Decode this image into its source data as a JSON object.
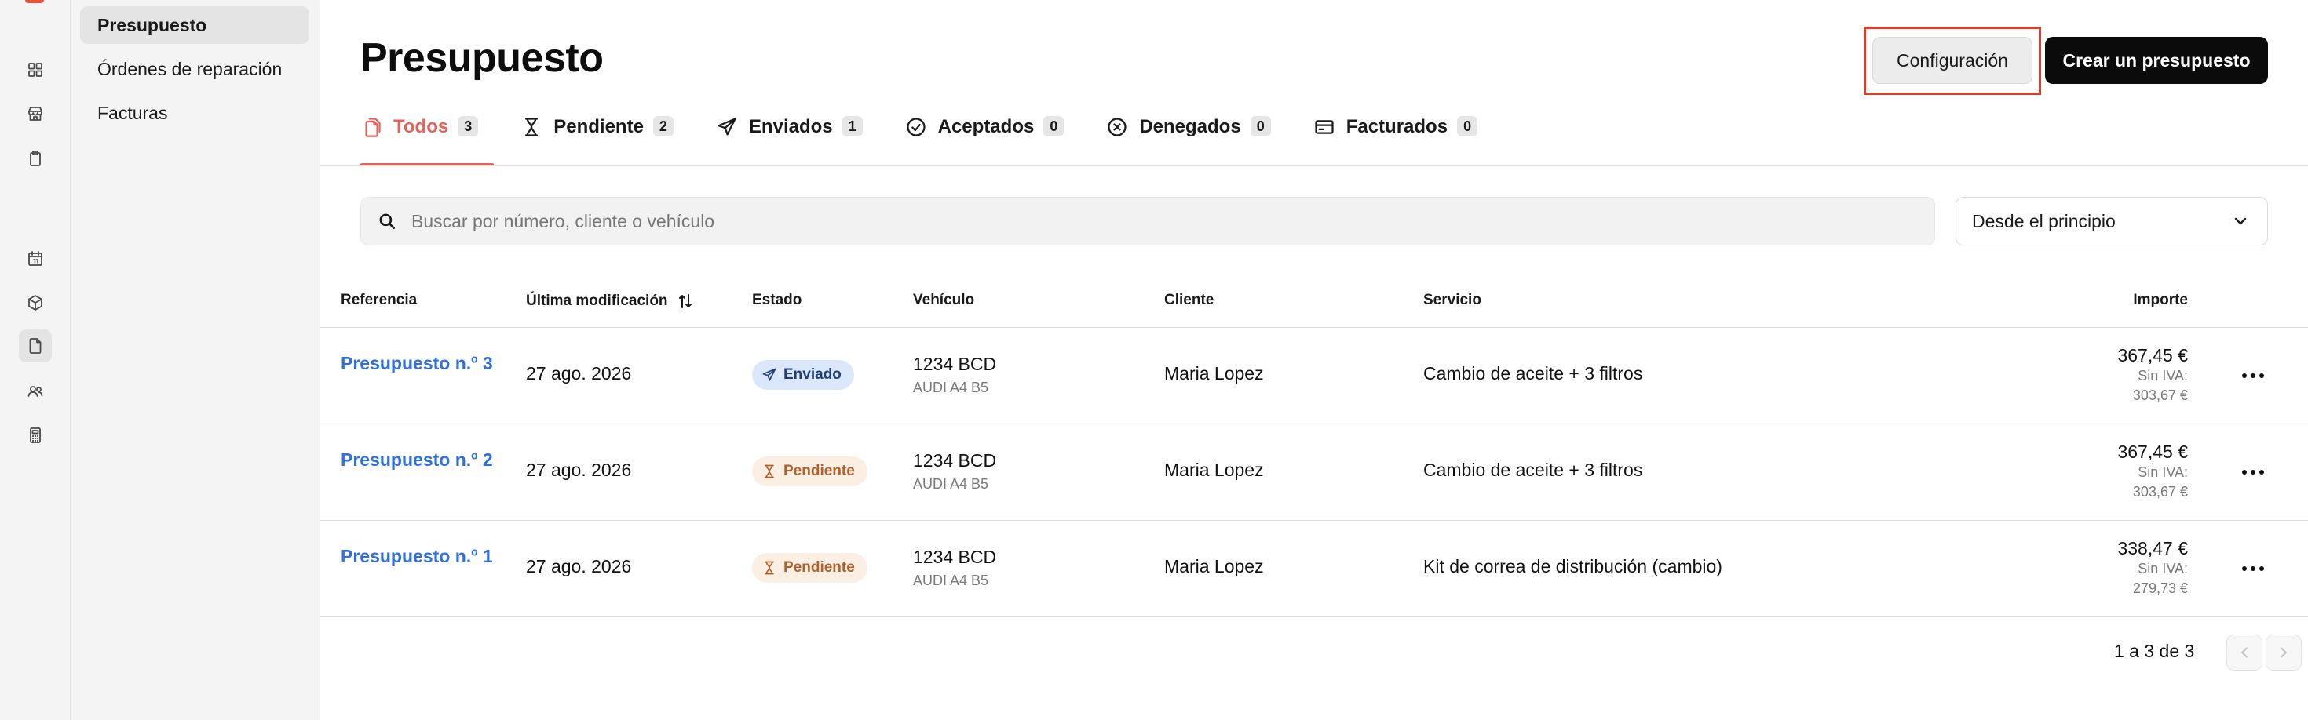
{
  "subnav": {
    "items": [
      {
        "label": "Presupuesto"
      },
      {
        "label": "Órdenes de reparación"
      },
      {
        "label": "Facturas"
      }
    ]
  },
  "header": {
    "title": "Presupuesto",
    "config_button": "Configuración",
    "create_button": "Crear un presupuesto"
  },
  "tabs": [
    {
      "label": "Todos",
      "count": "3"
    },
    {
      "label": "Pendiente",
      "count": "2"
    },
    {
      "label": "Enviados",
      "count": "1"
    },
    {
      "label": "Aceptados",
      "count": "0"
    },
    {
      "label": "Denegados",
      "count": "0"
    },
    {
      "label": "Facturados",
      "count": "0"
    }
  ],
  "search": {
    "placeholder": "Buscar por número, cliente o vehículo",
    "value": ""
  },
  "period_select": {
    "selected": "Desde el principio"
  },
  "table": {
    "headers": {
      "reference": "Referencia",
      "modified": "Última modificación",
      "status": "Estado",
      "vehicle": "Vehículo",
      "client": "Cliente",
      "service": "Servicio",
      "amount": "Importe"
    },
    "rows": [
      {
        "reference": "Presupuesto n.º 3",
        "modified": "27 ago. 2026",
        "status": "Enviado",
        "plate": "1234 BCD",
        "model": "AUDI A4 B5",
        "client": "Maria Lopez",
        "service": "Cambio de aceite + 3 filtros",
        "total": "367,45 €",
        "net_label": "Sin IVA:",
        "net": "303,67 €"
      },
      {
        "reference": "Presupuesto n.º 2",
        "modified": "27 ago. 2026",
        "status": "Pendiente",
        "plate": "1234 BCD",
        "model": "AUDI A4 B5",
        "client": "Maria Lopez",
        "service": "Cambio de aceite + 3 filtros",
        "total": "367,45 €",
        "net_label": "Sin IVA:",
        "net": "303,67 €"
      },
      {
        "reference": "Presupuesto n.º 1",
        "modified": "27 ago. 2026",
        "status": "Pendiente",
        "plate": "1234 BCD",
        "model": "AUDI A4 B5",
        "client": "Maria Lopez",
        "service": "Kit de correa de distribución (cambio)",
        "total": "338,47 €",
        "net_label": "Sin IVA:",
        "net": "279,73 €"
      }
    ]
  },
  "pagination": {
    "text": "1 a 3 de 3"
  },
  "colors": {
    "accent": "#e5615a",
    "link": "#2f6fe2",
    "highlight_border": "#e03c2a",
    "sent_badge_bg": "#dbe8fb",
    "pending_badge_bg": "#fbeee3"
  },
  "icons": {
    "rail": [
      "dashboard-icon",
      "store-icon",
      "clipboard-icon",
      "calendar-icon",
      "box-icon",
      "document-icon",
      "users-icon",
      "calculator-icon"
    ],
    "tabs": [
      "documents-icon",
      "hourglass-icon",
      "send-icon",
      "check-circle-icon",
      "x-circle-icon",
      "credit-card-icon"
    ]
  }
}
